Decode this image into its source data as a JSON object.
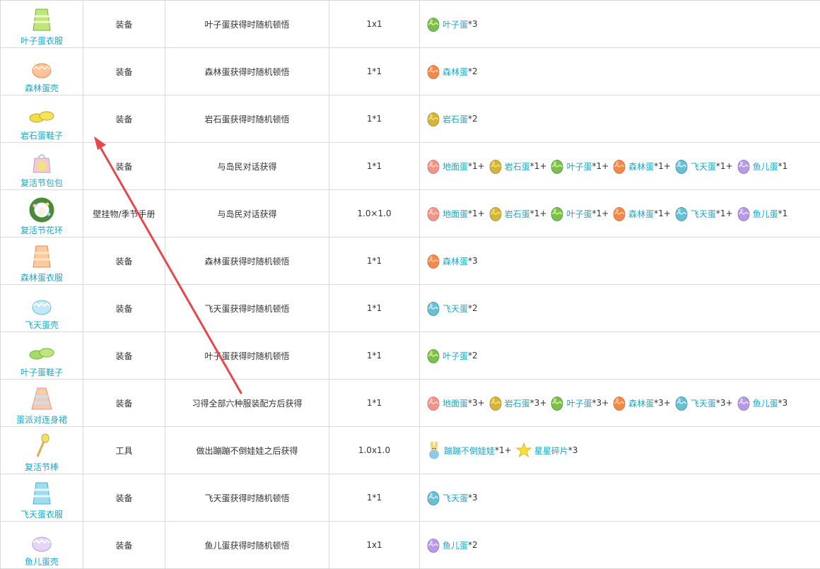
{
  "colors": {
    "link": "#1ba8c6",
    "border": "#d9d9d9",
    "arrow": "#e8474b"
  },
  "rows": [
    {
      "name": "叶子蛋衣服",
      "type": "装备",
      "source": "叶子蛋获得时随机顿悟",
      "size": "1x1",
      "icon": "leaf-egg-outfit-icon",
      "materials": [
        {
          "name": "叶子蛋",
          "qty": "*3",
          "egg": "leaf-egg-icon"
        }
      ]
    },
    {
      "name": "森林蛋壳",
      "type": "装备",
      "source": "森林蛋获得时随机顿悟",
      "size": "1*1",
      "icon": "forest-egg-shell-icon",
      "materials": [
        {
          "name": "森林蛋",
          "qty": "*2",
          "egg": "forest-egg-icon"
        }
      ]
    },
    {
      "name": "岩石蛋鞋子",
      "type": "装备",
      "source": "岩石蛋获得时随机顿悟",
      "size": "1*1",
      "icon": "rock-egg-shoes-icon",
      "materials": [
        {
          "name": "岩石蛋",
          "qty": "*2",
          "egg": "rock-egg-icon"
        }
      ]
    },
    {
      "name": "复活节包包",
      "type": "装备",
      "source": "与岛民对话获得",
      "size": "1*1",
      "icon": "easter-bag-icon",
      "materials": [
        {
          "name": "地面蛋",
          "qty": "*1+",
          "egg": "earth-egg-icon"
        },
        {
          "name": "岩石蛋",
          "qty": "*1+",
          "egg": "rock-egg-icon"
        },
        {
          "name": "叶子蛋",
          "qty": "*1+",
          "egg": "leaf-egg-icon"
        },
        {
          "name": "森林蛋",
          "qty": "*1+",
          "egg": "forest-egg-icon"
        },
        {
          "name": "飞天蛋",
          "qty": "*1+",
          "egg": "sky-egg-icon"
        },
        {
          "name": "鱼儿蛋",
          "qty": "*1",
          "egg": "water-egg-icon"
        }
      ]
    },
    {
      "name": "复活节花环",
      "type": "壁挂物/季节手册",
      "source": "与岛民对话获得",
      "size": "1.0×1.0",
      "icon": "easter-wreath-icon",
      "materials": [
        {
          "name": "地面蛋",
          "qty": "*1+",
          "egg": "earth-egg-icon"
        },
        {
          "name": "岩石蛋",
          "qty": "*1+",
          "egg": "rock-egg-icon"
        },
        {
          "name": "叶子蛋",
          "qty": "*1+",
          "egg": "leaf-egg-icon"
        },
        {
          "name": "森林蛋",
          "qty": "*1+",
          "egg": "forest-egg-icon"
        },
        {
          "name": "飞天蛋",
          "qty": "*1+",
          "egg": "sky-egg-icon"
        },
        {
          "name": "鱼儿蛋",
          "qty": "*1",
          "egg": "water-egg-icon"
        }
      ]
    },
    {
      "name": "森林蛋衣服",
      "type": "装备",
      "source": "森林蛋获得时随机顿悟",
      "size": "1*1",
      "icon": "forest-egg-outfit-icon",
      "materials": [
        {
          "name": "森林蛋",
          "qty": "*3",
          "egg": "forest-egg-icon"
        }
      ]
    },
    {
      "name": "飞天蛋壳",
      "type": "装备",
      "source": "飞天蛋获得时随机顿悟",
      "size": "1*1",
      "icon": "sky-egg-shell-icon",
      "materials": [
        {
          "name": "飞天蛋",
          "qty": "*2",
          "egg": "sky-egg-icon"
        }
      ]
    },
    {
      "name": "叶子蛋鞋子",
      "type": "装备",
      "source": "叶子蛋获得时随机顿悟",
      "size": "1*1",
      "icon": "leaf-egg-shoes-icon",
      "materials": [
        {
          "name": "叶子蛋",
          "qty": "*2",
          "egg": "leaf-egg-icon"
        }
      ]
    },
    {
      "name": "蛋派对连身裙",
      "type": "装备",
      "source": "习得全部六种服装配方后获得",
      "size": "1*1",
      "icon": "egg-party-dress-icon",
      "materials": [
        {
          "name": "地面蛋",
          "qty": "*3+",
          "egg": "earth-egg-icon"
        },
        {
          "name": "岩石蛋",
          "qty": "*3+",
          "egg": "rock-egg-icon"
        },
        {
          "name": "叶子蛋",
          "qty": "*3+",
          "egg": "leaf-egg-icon"
        },
        {
          "name": "森林蛋",
          "qty": "*3+",
          "egg": "forest-egg-icon"
        },
        {
          "name": "飞天蛋",
          "qty": "*3+",
          "egg": "sky-egg-icon"
        },
        {
          "name": "鱼儿蛋",
          "qty": "*3",
          "egg": "water-egg-icon"
        }
      ]
    },
    {
      "name": "复活节棒",
      "type": "工具",
      "source": "做出蹦蹦不倒娃娃之后获得",
      "size": "1.0x1.0",
      "icon": "easter-wand-icon",
      "materials": [
        {
          "name": "蹦蹦不倒娃娃",
          "qty": "*1+",
          "egg": "bunny-tumbler-icon"
        },
        {
          "name": "星星碎片",
          "qty": "*3",
          "egg": "star-fragment-icon"
        }
      ]
    },
    {
      "name": "飞天蛋衣服",
      "type": "装备",
      "source": "飞天蛋获得时随机顿悟",
      "size": "1*1",
      "icon": "sky-egg-outfit-icon",
      "materials": [
        {
          "name": "飞天蛋",
          "qty": "*3",
          "egg": "sky-egg-icon"
        }
      ]
    },
    {
      "name": "鱼儿蛋壳",
      "type": "装备",
      "source": "鱼儿蛋获得时随机顿悟",
      "size": "1x1",
      "icon": "water-egg-shell-icon",
      "materials": [
        {
          "name": "鱼儿蛋",
          "qty": "*2",
          "egg": "water-egg-icon"
        }
      ]
    }
  ]
}
